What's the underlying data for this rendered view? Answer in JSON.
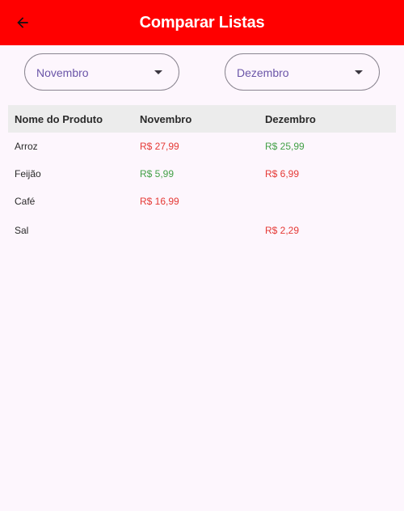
{
  "app_bar": {
    "title": "Comparar Listas",
    "background": "#ff0000",
    "back_icon": "arrow-left-icon"
  },
  "selectors": {
    "first_month": "Novembro",
    "second_month": "Dezembro"
  },
  "table": {
    "headers": [
      "Nome do Produto",
      "Novembro",
      "Dezembro"
    ],
    "rows": [
      {
        "product": "Arroz",
        "first": "R$ 27,99",
        "first_status": "high",
        "second": "R$ 25,99",
        "second_status": "low"
      },
      {
        "product": "Feijão",
        "first": "R$ 5,99",
        "first_status": "low",
        "second": "R$ 6,99",
        "second_status": "high"
      },
      {
        "product": "Café",
        "first": "R$ 16,99",
        "first_status": "high",
        "second": "",
        "second_status": ""
      },
      {
        "product": "Sal",
        "first": "",
        "first_status": "",
        "second": "R$ 2,29",
        "second_status": "high"
      }
    ]
  },
  "colors": {
    "price_high": "#e53935",
    "price_low": "#43a047",
    "accent": "#6a55a8"
  }
}
